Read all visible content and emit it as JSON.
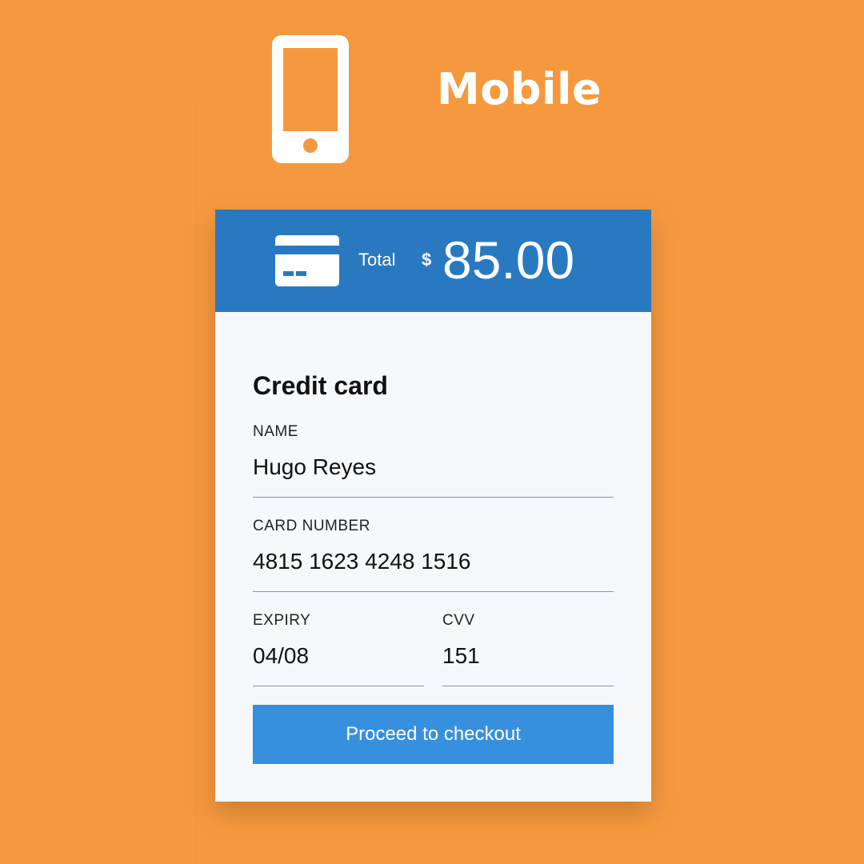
{
  "hero": {
    "icon": "mobile-phone-icon",
    "title": "Mobile"
  },
  "payment": {
    "header": {
      "icon": "credit-card-icon",
      "total_label": "Total",
      "currency": "$",
      "amount": "85.00"
    },
    "section_title": "Credit card",
    "fields": {
      "name": {
        "label": "NAME",
        "value": "Hugo Reyes"
      },
      "card_number": {
        "label": "CARD NUMBER",
        "value": "4815 1623 4248 1516"
      },
      "expiry": {
        "label": "EXPIRY",
        "value": "04/08"
      },
      "cvv": {
        "label": "CVV",
        "value": "151"
      }
    },
    "checkout_label": "Proceed to checkout"
  },
  "colors": {
    "background": "#f6993e",
    "header": "#2979c1",
    "card": "#f6f8fc",
    "button": "#3690de",
    "underline": "#8a94a3"
  }
}
